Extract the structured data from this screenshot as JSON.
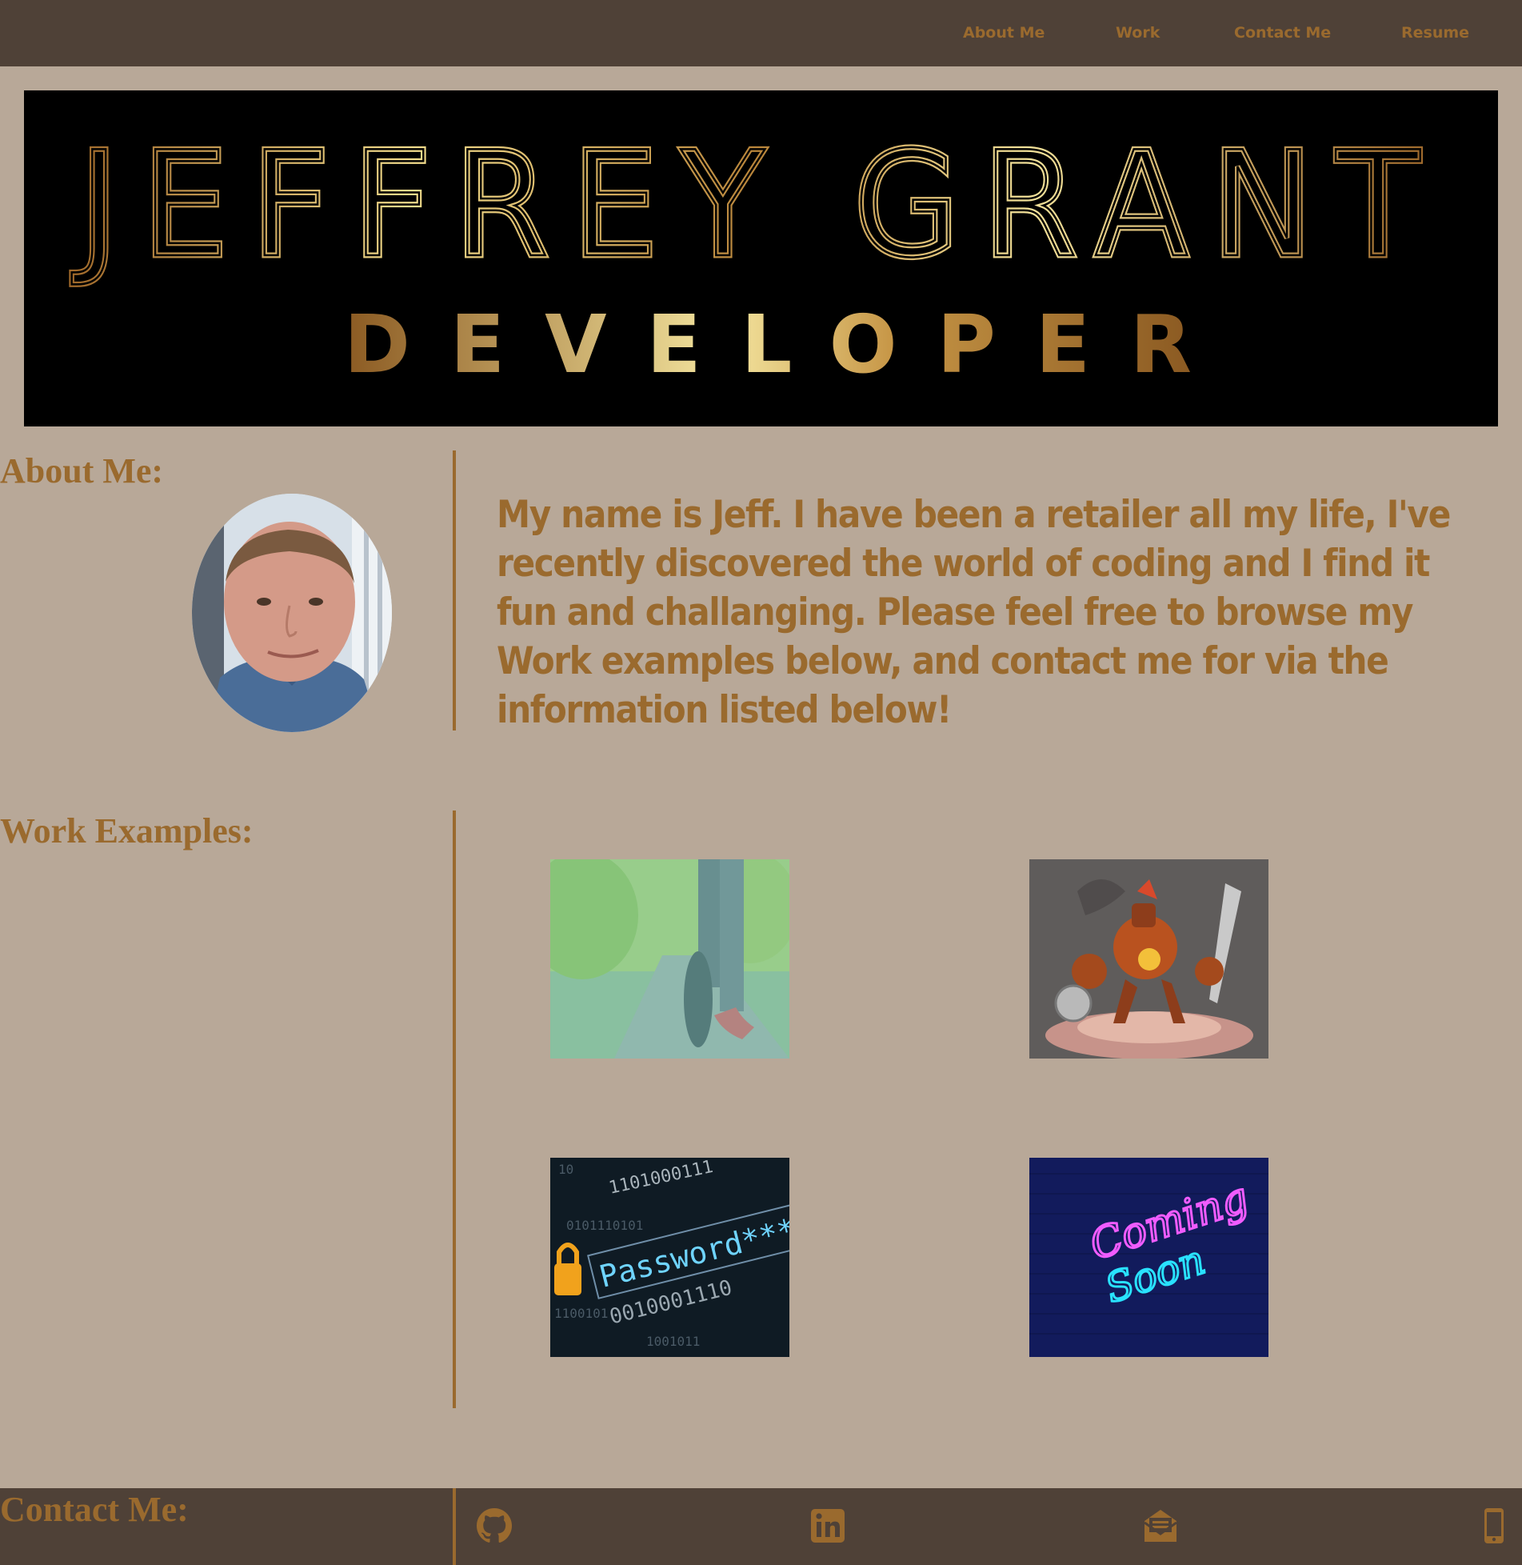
{
  "nav": {
    "items": [
      {
        "label": "About Me"
      },
      {
        "label": "Work"
      },
      {
        "label": "Contact Me"
      },
      {
        "label": "Resume"
      }
    ]
  },
  "banner": {
    "name": "JEFFREY GRANT",
    "role": "DEVELOPER"
  },
  "about": {
    "heading": "About Me:",
    "text": "My name is Jeff. I have been a retailer all my life, I've recently discovered the world of coding and I find it fun and challanging. Please feel free to browse my Work examples below, and contact me for via the information listed below!"
  },
  "work": {
    "heading": "Work Examples:",
    "thumbnails": [
      {
        "image": "runner-tying-shoe-photo"
      },
      {
        "image": "steampunk-robot-gladiator-illustration"
      },
      {
        "image": "password-binary-lock-image"
      },
      {
        "image": "coming-soon-neon-sign-image",
        "text": [
          "Coming",
          "Soon"
        ]
      }
    ]
  },
  "contact": {
    "heading": "Contact Me:",
    "icons": [
      "github-icon",
      "linkedin-icon",
      "email-icon",
      "phone-icon"
    ]
  },
  "colors": {
    "background": "#b8a898",
    "bar": "#4f4137",
    "accent": "#9a6a2e",
    "banner_bg": "#000000"
  }
}
